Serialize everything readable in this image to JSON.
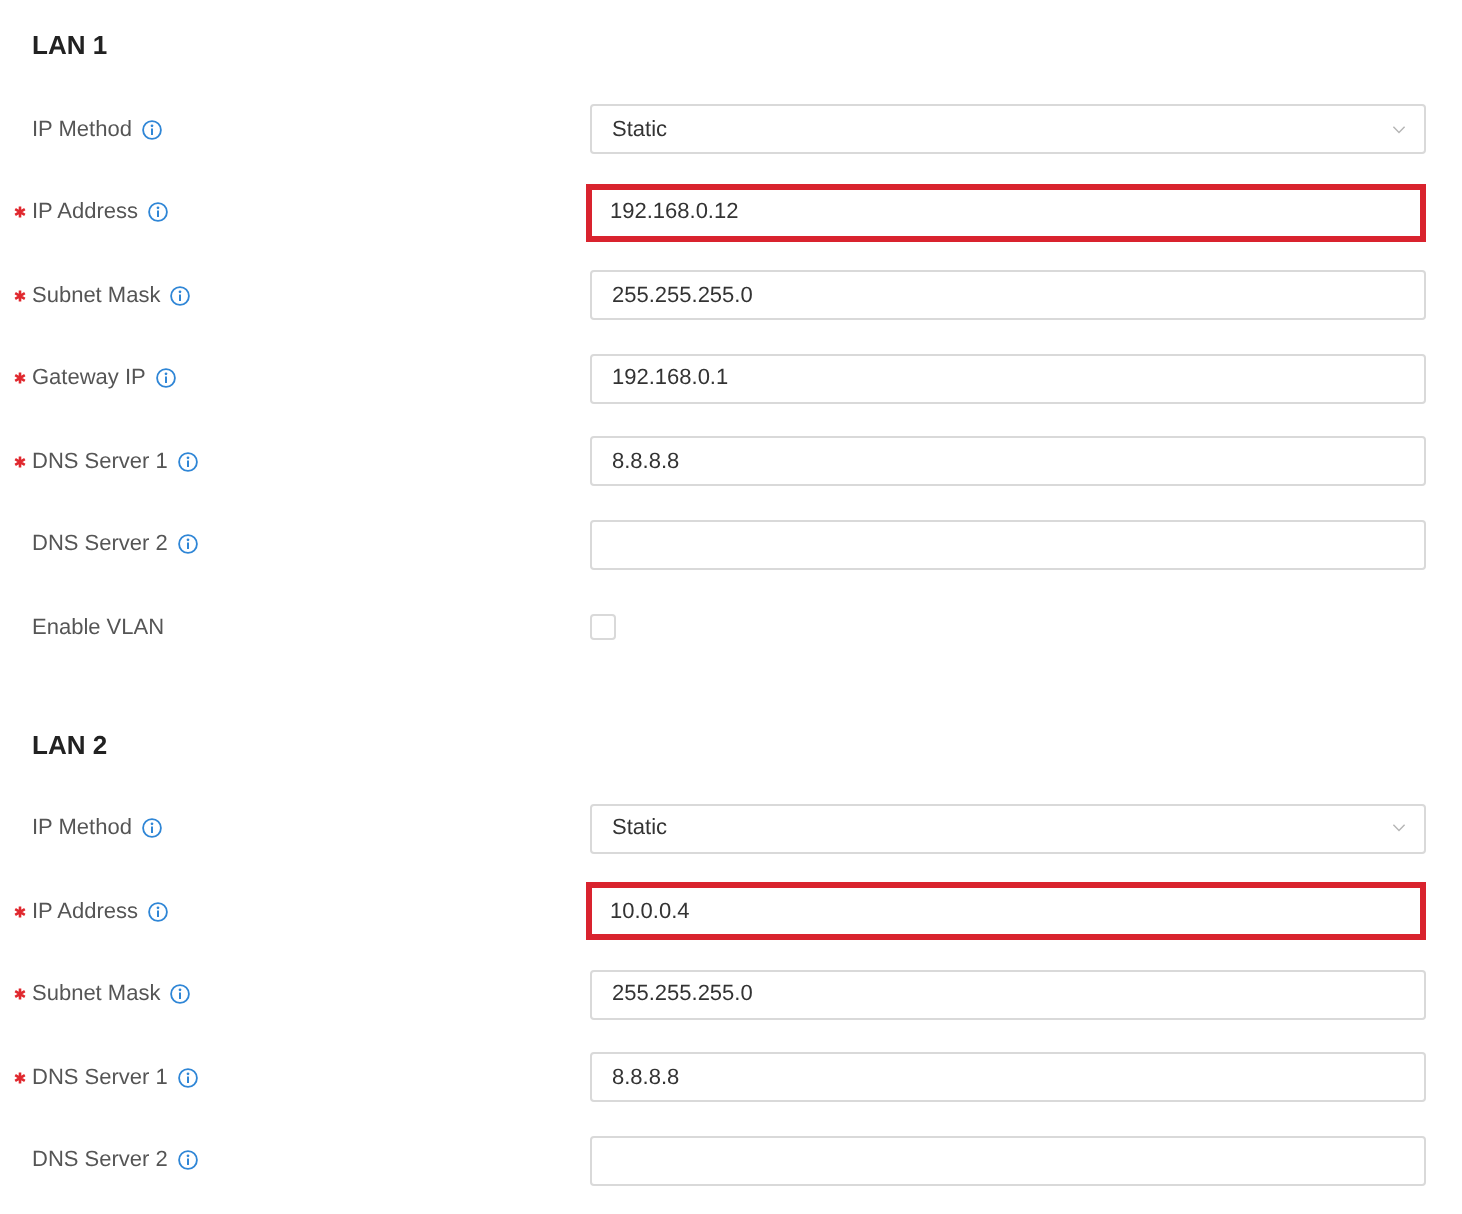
{
  "sections": [
    {
      "title": "LAN 1",
      "fields": [
        {
          "label": "IP Method",
          "required": false,
          "info": true,
          "kind": "select",
          "value": "Static",
          "highlighted": false
        },
        {
          "label": "IP Address",
          "required": true,
          "info": true,
          "kind": "text",
          "value": "192.168.0.12",
          "highlighted": true
        },
        {
          "label": "Subnet Mask",
          "required": true,
          "info": true,
          "kind": "text",
          "value": "255.255.255.0",
          "highlighted": false
        },
        {
          "label": "Gateway IP",
          "required": true,
          "info": true,
          "kind": "text",
          "value": "192.168.0.1",
          "highlighted": false
        },
        {
          "label": "DNS Server 1",
          "required": true,
          "info": true,
          "kind": "text",
          "value": "8.8.8.8",
          "highlighted": false
        },
        {
          "label": "DNS Server 2",
          "required": false,
          "info": true,
          "kind": "text",
          "highlighted": false
        },
        {
          "label": "Enable VLAN",
          "required": false,
          "info": false,
          "kind": "checkbox",
          "checked": false
        }
      ]
    },
    {
      "title": "LAN 2",
      "fields": [
        {
          "label": "IP Method",
          "required": false,
          "info": true,
          "kind": "select",
          "value": "Static",
          "highlighted": false
        },
        {
          "label": "IP Address",
          "required": true,
          "info": true,
          "kind": "text",
          "value": "10.0.0.4",
          "highlighted": true
        },
        {
          "label": "Subnet Mask",
          "required": true,
          "info": true,
          "kind": "text",
          "value": "255.255.255.0",
          "highlighted": false
        },
        {
          "label": "DNS Server 1",
          "required": true,
          "info": true,
          "kind": "text",
          "value": "8.8.8.8",
          "highlighted": false
        },
        {
          "label": "DNS Server 2",
          "required": false,
          "info": true,
          "kind": "text",
          "highlighted": false
        }
      ]
    }
  ]
}
